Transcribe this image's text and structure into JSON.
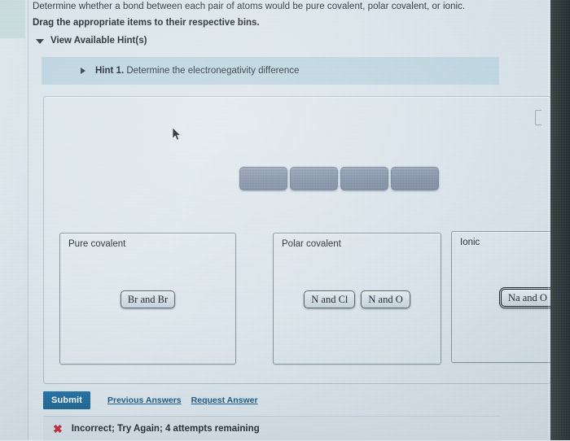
{
  "question": {
    "prompt": "Determine whether a bond between each pair of atoms would be pure covalent, polar covalent, or ionic.",
    "instruction": "Drag the appropriate items to their respective bins."
  },
  "hints": {
    "toggle_label": "View Available Hint(s)",
    "toggle_icon": "caret-down-icon",
    "items": [
      {
        "expand_icon": "caret-right-icon",
        "title": "Hint 1.",
        "text": "Determine the electronegativity difference"
      }
    ]
  },
  "answer_area": {
    "resize_handle_icon": "bracket-handle-icon",
    "source_slots": [
      {
        "label": "",
        "state": "empty"
      },
      {
        "label": "",
        "state": "empty"
      },
      {
        "label": "",
        "state": "empty"
      },
      {
        "label": "",
        "state": "empty"
      }
    ],
    "bins": [
      {
        "id": "pure-covalent",
        "title": "Pure covalent",
        "items": [
          {
            "label": "Br and Br",
            "selected": false
          }
        ]
      },
      {
        "id": "polar-covalent",
        "title": "Polar covalent",
        "items": [
          {
            "label": "N and Cl",
            "selected": false
          },
          {
            "label": "N and O",
            "selected": false
          }
        ]
      },
      {
        "id": "ionic",
        "title": "Ionic",
        "items": [
          {
            "label": "Na and O",
            "selected": true
          }
        ]
      }
    ]
  },
  "actions": {
    "submit_label": "Submit",
    "previous_answers_label": "Previous Answers",
    "request_answer_label": "Request Answer"
  },
  "feedback": {
    "status_icon": "x-mark-icon",
    "status_symbol": "✖",
    "message": "Incorrect; Try Again; 4 attempts remaining",
    "color": "#c62333"
  },
  "cursor": {
    "icon": "mouse-pointer-icon"
  },
  "colors": {
    "page_background": "#dce6ec",
    "hint_bar": "#bdd5e0",
    "submit_button": "#1d6fa5",
    "link": "#14557f",
    "slot_fill": "#7e8da3",
    "error": "#c62333"
  }
}
